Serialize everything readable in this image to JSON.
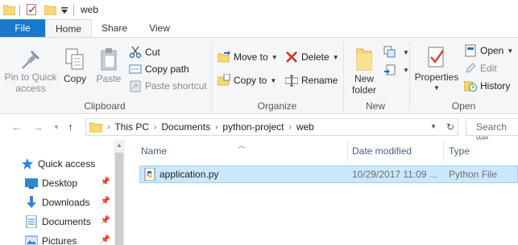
{
  "titlebar": {
    "title": "web",
    "qat_dropdown": "▾"
  },
  "tabs": {
    "file": "File",
    "home": "Home",
    "share": "Share",
    "view": "View"
  },
  "ribbon": {
    "clipboard": {
      "group": "Clipboard",
      "pin_line1": "Pin to Quick",
      "pin_line2": "access",
      "copy": "Copy",
      "paste": "Paste",
      "cut": "Cut",
      "copy_path": "Copy path",
      "paste_shortcut": "Paste shortcut"
    },
    "organize": {
      "group": "Organize",
      "move_to": "Move to",
      "copy_to": "Copy to",
      "delete": "Delete",
      "rename": "Rename"
    },
    "new": {
      "group": "New",
      "new_folder_line1": "New",
      "new_folder_line2": "folder"
    },
    "open": {
      "group": "Open",
      "properties": "Properties",
      "open": "Open",
      "edit": "Edit",
      "history": "History"
    }
  },
  "address": {
    "crumbs": [
      "This PC",
      "Documents",
      "python-project",
      "web"
    ],
    "search_placeholder": "Search we"
  },
  "nav": {
    "items": [
      {
        "label": "Quick access"
      },
      {
        "label": "Desktop"
      },
      {
        "label": "Downloads"
      },
      {
        "label": "Documents"
      },
      {
        "label": "Pictures"
      }
    ]
  },
  "columns": {
    "name": "Name",
    "date": "Date modified",
    "type": "Type"
  },
  "files": [
    {
      "name": "application.py",
      "date": "10/29/2017 11:09 ...",
      "type": "Python File"
    }
  ],
  "colors": {
    "accent": "#1979ca",
    "selection": "#cce8ff",
    "selection_border": "#99d1ff",
    "ribbon_bg": "#f5f6f7"
  }
}
